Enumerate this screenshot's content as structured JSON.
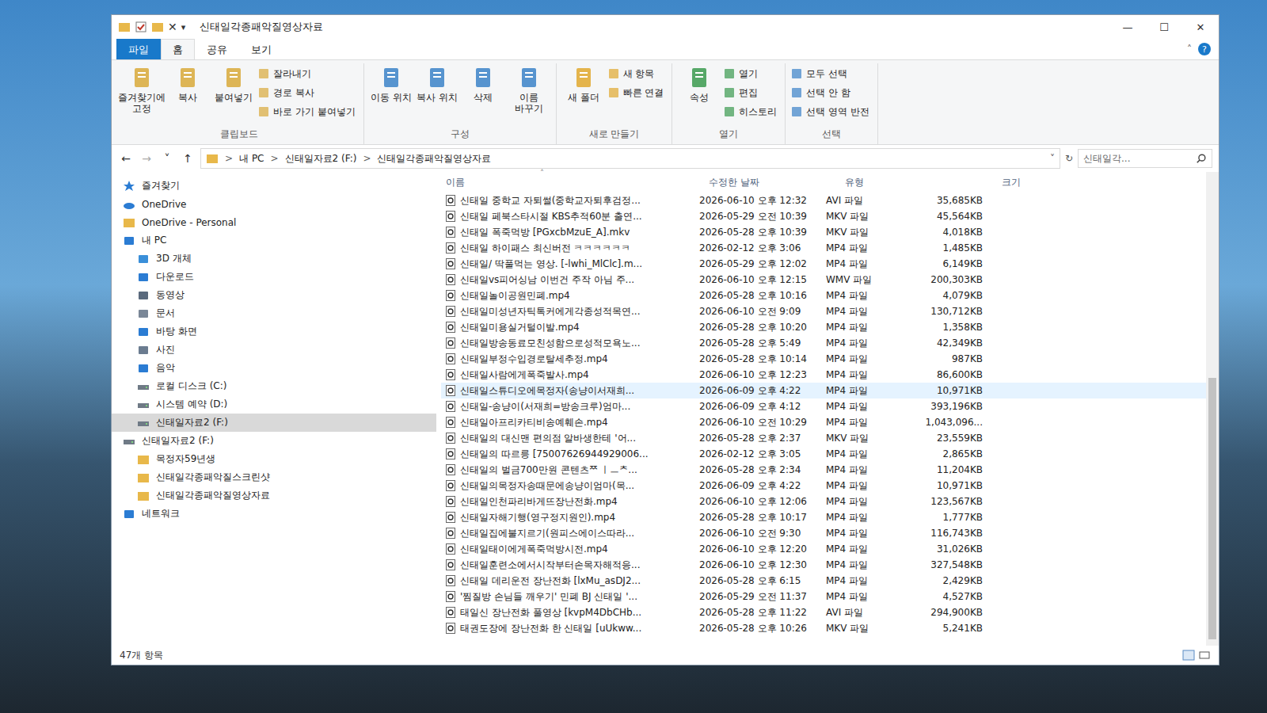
{
  "window": {
    "title": "신태일각종패악질영상자료",
    "quick_toolbar": [
      "✕",
      "▾"
    ],
    "controls": [
      "—",
      "☐",
      "✕"
    ]
  },
  "ribbon": {
    "tabs": [
      {
        "label": "파일",
        "selected": false,
        "kind": "file"
      },
      {
        "label": "홈",
        "selected": true,
        "kind": "tab"
      },
      {
        "label": "공유",
        "selected": false,
        "kind": "tab"
      },
      {
        "label": "보기",
        "selected": false,
        "kind": "tab"
      }
    ],
    "collapse": "˄",
    "help": "?",
    "groups": [
      {
        "label": "클립보드",
        "items": [
          {
            "label": "즐겨찾기에 고정",
            "kind": "large"
          },
          {
            "label": "복사",
            "kind": "large"
          },
          {
            "label": "붙여넣기",
            "kind": "large"
          },
          {
            "label": "잘라내기",
            "kind": "small"
          },
          {
            "label": "경로 복사",
            "kind": "small"
          },
          {
            "label": "바로 가기 붙여넣기",
            "kind": "small"
          }
        ]
      },
      {
        "label": "구성",
        "items": [
          {
            "label": "이동 위치",
            "kind": "large"
          },
          {
            "label": "복사 위치",
            "kind": "large"
          },
          {
            "label": "삭제",
            "kind": "large"
          },
          {
            "label": "이름 바꾸기",
            "kind": "large"
          }
        ]
      },
      {
        "label": "새로 만들기",
        "items": [
          {
            "label": "새 폴더",
            "kind": "large"
          },
          {
            "label": "새 항목",
            "kind": "small"
          },
          {
            "label": "빠른 연결",
            "kind": "small"
          }
        ]
      },
      {
        "label": "열기",
        "items": [
          {
            "label": "속성",
            "kind": "large"
          },
          {
            "label": "열기",
            "kind": "small"
          },
          {
            "label": "편집",
            "kind": "small"
          },
          {
            "label": "히스토리",
            "kind": "small"
          }
        ]
      },
      {
        "label": "선택",
        "items": [
          {
            "label": "모두 선택",
            "kind": "small"
          },
          {
            "label": "선택 안 함",
            "kind": "small"
          },
          {
            "label": "선택 영역 반전",
            "kind": "small"
          }
        ]
      }
    ]
  },
  "address": {
    "nav": [
      "←",
      "→",
      "˅",
      "↑"
    ],
    "path": [
      "내 PC",
      "신태일자료2 (F:)",
      "신태일각종패악질영상자료"
    ],
    "separator": ">",
    "dropdown": "˅",
    "refresh": "↻",
    "search_placeholder": "신태일각..."
  },
  "sidebar": {
    "items": [
      {
        "label": "즐겨찾기",
        "kind": "star",
        "indent": 0,
        "selected": false
      },
      {
        "label": "OneDrive",
        "kind": "cloud",
        "indent": 0,
        "selected": false
      },
      {
        "label": "OneDrive - Personal",
        "kind": "folder",
        "indent": 0,
        "selected": false
      },
      {
        "label": "내 PC",
        "kind": "pc",
        "indent": 0,
        "selected": false
      },
      {
        "label": "3D 개체",
        "kind": "cube",
        "indent": 1,
        "selected": false
      },
      {
        "label": "다운로드",
        "kind": "download",
        "indent": 1,
        "selected": false
      },
      {
        "label": "동영상",
        "kind": "video",
        "indent": 1,
        "selected": false
      },
      {
        "label": "문서",
        "kind": "doc",
        "indent": 1,
        "selected": false
      },
      {
        "label": "바탕 화면",
        "kind": "desktop",
        "indent": 1,
        "selected": false
      },
      {
        "label": "사진",
        "kind": "picture",
        "indent": 1,
        "selected": false
      },
      {
        "label": "음악",
        "kind": "music",
        "indent": 1,
        "selected": false
      },
      {
        "label": "로컬 디스크 (C:)",
        "kind": "drive",
        "indent": 1,
        "selected": false
      },
      {
        "label": "시스템 예약 (D:)",
        "kind": "drive",
        "indent": 1,
        "selected": false
      },
      {
        "label": "신태일자료2 (F:)",
        "kind": "drive",
        "indent": 1,
        "selected": true
      },
      {
        "label": "신태일자료2 (F:)",
        "kind": "drive",
        "indent": 0,
        "selected": false
      },
      {
        "label": "목정자59년생",
        "kind": "folder",
        "indent": 1,
        "selected": false
      },
      {
        "label": "신태일각종패악질스크린샷",
        "kind": "folder",
        "indent": 1,
        "selected": false
      },
      {
        "label": "신태일각종패악질영상자료",
        "kind": "folder",
        "indent": 1,
        "selected": false
      },
      {
        "label": "네트워크",
        "kind": "network",
        "indent": 0,
        "selected": false
      }
    ]
  },
  "table": {
    "sort_glyph": "˄",
    "columns": [
      {
        "label": "이름"
      },
      {
        "label": "수정한 날짜"
      },
      {
        "label": "유형"
      },
      {
        "label": "크기"
      }
    ],
    "rows": [
      {
        "name": "신태일 중학교 자퇴썰(중학교자퇴후검정...",
        "date": "2026-06-10 오후 12:32",
        "type": "AVI 파일",
        "size": "35,685KB",
        "selected": false,
        "hovered": false
      },
      {
        "name": "신태일 페북스타시절 KBS추적60분 출연...",
        "date": "2026-05-29 오전 10:39",
        "type": "MKV 파일",
        "size": "45,564KB",
        "selected": false,
        "hovered": false
      },
      {
        "name": "신태일 폭죽먹방 [PGxcbMzuE_A].mkv",
        "date": "2026-05-28 오후 10:39",
        "type": "MKV 파일",
        "size": "4,018KB",
        "selected": false,
        "hovered": false
      },
      {
        "name": "신태일 하이패스 최신버전 ㅋㅋㅋㅋㅋㅋ",
        "date": "2026-02-12 오후 3:06",
        "type": "MP4 파일",
        "size": "1,485KB",
        "selected": false,
        "hovered": false
      },
      {
        "name": "신태일/ 딱풀먹는 영상. [-lwhi_MlClc].m...",
        "date": "2026-05-29 오후 12:02",
        "type": "MP4 파일",
        "size": "6,149KB",
        "selected": false,
        "hovered": false
      },
      {
        "name": "신태일vs피어싱남 이번건 주작 아님 주...",
        "date": "2026-06-10 오후 12:15",
        "type": "WMV 파일",
        "size": "200,303KB",
        "selected": false,
        "hovered": false
      },
      {
        "name": "신태일놀이공원민폐.mp4",
        "date": "2026-05-28 오후 10:16",
        "type": "MP4 파일",
        "size": "4,079KB",
        "selected": false,
        "hovered": false
      },
      {
        "name": "신태일미성년자틱톡커에게각종성적목연...",
        "date": "2026-06-10 오전 9:09",
        "type": "MP4 파일",
        "size": "130,712KB",
        "selected": false,
        "hovered": false
      },
      {
        "name": "신태일미용실거털이발.mp4",
        "date": "2026-05-28 오후 10:20",
        "type": "MP4 파일",
        "size": "1,358KB",
        "selected": false,
        "hovered": false
      },
      {
        "name": "신태일방송동료모친성함으로성적모욕노...",
        "date": "2026-05-28 오후 5:49",
        "type": "MP4 파일",
        "size": "42,349KB",
        "selected": false,
        "hovered": false
      },
      {
        "name": "신태일부정수입경로탈세추정.mp4",
        "date": "2026-05-28 오후 10:14",
        "type": "MP4 파일",
        "size": "987KB",
        "selected": false,
        "hovered": false
      },
      {
        "name": "신태일사람에게폭죽발사.mp4",
        "date": "2026-06-10 오후 12:23",
        "type": "MP4 파일",
        "size": "86,600KB",
        "selected": false,
        "hovered": false
      },
      {
        "name": "신태일스튜디오에목정자(송냥이서재희...",
        "date": "2026-06-09 오후 4:22",
        "type": "MP4 파일",
        "size": "10,971KB",
        "selected": false,
        "hovered": true
      },
      {
        "name": "신태일-송냥이(서재희=방송크루)엄마...",
        "date": "2026-06-09 오후 4:12",
        "type": "MP4 파일",
        "size": "393,196KB",
        "selected": false,
        "hovered": false
      },
      {
        "name": "신태일아프리카티비송예훼손.mp4",
        "date": "2026-06-10 오전 10:29",
        "type": "MP4 파일",
        "size": "1,043,096...",
        "selected": false,
        "hovered": false
      },
      {
        "name": "신태일의 대신맨 편의점 알바생한테 '어...",
        "date": "2026-05-28 오후 2:37",
        "type": "MKV 파일",
        "size": "23,559KB",
        "selected": false,
        "hovered": false
      },
      {
        "name": "신태일의 따르릉 [75007626944929006...",
        "date": "2026-02-12 오후 3:05",
        "type": "MP4 파일",
        "size": "2,865KB",
        "selected": false,
        "hovered": false
      },
      {
        "name": "신태일의 벌금700만원 콘텐츠ᄍ ㅣㅡᄎ...",
        "date": "2026-05-28 오후 2:34",
        "type": "MP4 파일",
        "size": "11,204KB",
        "selected": false,
        "hovered": false
      },
      {
        "name": "신태일의목정자송때문에송냥이엄마(목...",
        "date": "2026-06-09 오후 4:22",
        "type": "MP4 파일",
        "size": "10,971KB",
        "selected": false,
        "hovered": false
      },
      {
        "name": "신태일인천파리바게뜨장난전화.mp4",
        "date": "2026-06-10 오후 12:06",
        "type": "MP4 파일",
        "size": "123,567KB",
        "selected": false,
        "hovered": false
      },
      {
        "name": "신태일자해기행(영구정지원인).mp4",
        "date": "2026-05-28 오후 10:17",
        "type": "MP4 파일",
        "size": "1,777KB",
        "selected": false,
        "hovered": false
      },
      {
        "name": "신태일집에불지르기(원피스에이스따라...",
        "date": "2026-06-10 오전 9:30",
        "type": "MP4 파일",
        "size": "116,743KB",
        "selected": false,
        "hovered": false
      },
      {
        "name": "신태일태이에게폭죽먹방시전.mp4",
        "date": "2026-06-10 오후 12:20",
        "type": "MP4 파일",
        "size": "31,026KB",
        "selected": false,
        "hovered": false
      },
      {
        "name": "신태일훈련소에서시작부터손목자해적응...",
        "date": "2026-06-10 오후 12:30",
        "type": "MP4 파일",
        "size": "327,548KB",
        "selected": false,
        "hovered": false
      },
      {
        "name": "신태일 데리운전 장난전화 [lxMu_asDJ2...",
        "date": "2026-05-28 오후 6:15",
        "type": "MP4 파일",
        "size": "2,429KB",
        "selected": false,
        "hovered": false
      },
      {
        "name": "'찜질방 손님들 깨우기' 민폐 BJ 신태일 '...",
        "date": "2026-05-29 오전 11:37",
        "type": "MP4 파일",
        "size": "4,527KB",
        "selected": false,
        "hovered": false
      },
      {
        "name": "태일신 장난전화 풀영상 [kvpM4DbCHb...",
        "date": "2026-05-28 오후 11:22",
        "type": "AVI 파일",
        "size": "294,900KB",
        "selected": false,
        "hovered": false
      },
      {
        "name": "태권도장에 장난전화 한 신태일 [uUkww...",
        "date": "2026-05-28 오후 10:26",
        "type": "MKV 파일",
        "size": "5,241KB",
        "selected": false,
        "hovered": false
      }
    ]
  },
  "status_bar": {
    "count": "47개 항목"
  }
}
